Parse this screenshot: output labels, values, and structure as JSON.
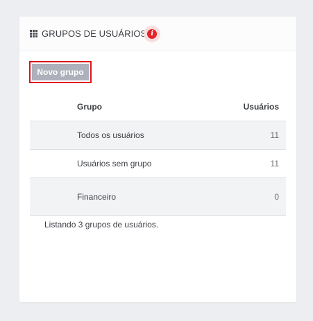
{
  "panel": {
    "title": "GRUPOS DE USUÁRIOS",
    "header_icon": "grid-icon",
    "info_icon": "info-icon",
    "info_glyph": "i"
  },
  "toolbar": {
    "new_group_label": "Novo grupo"
  },
  "table": {
    "columns": {
      "group": "Grupo",
      "users": "Usuários"
    },
    "rows": [
      {
        "group": "Todos os usuários",
        "users": "11"
      },
      {
        "group": "Usuários sem grupo",
        "users": "11"
      },
      {
        "group": "Financeiro",
        "users": "0"
      }
    ]
  },
  "footer": {
    "summary": "Listando 3 grupos de usuários."
  },
  "colors": {
    "accent_red": "#e3242b",
    "button_bg": "#aeb1bb",
    "row_alt_bg": "#f2f3f5"
  }
}
